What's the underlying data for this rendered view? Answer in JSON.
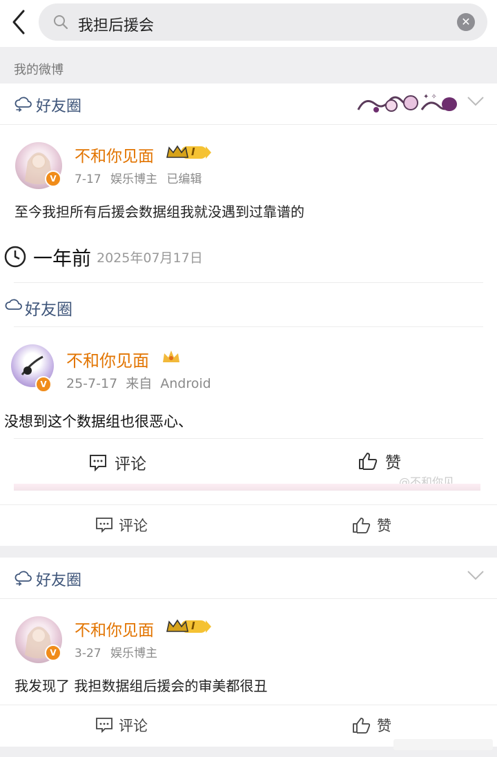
{
  "search": {
    "query": "我担后援会"
  },
  "section_label": "我的微博",
  "posts": [
    {
      "circle": "好友圈",
      "username": "不和你见面",
      "level": "I",
      "meta": "7-17   娱乐博主   已编辑",
      "text": "至今我担所有后援会数据组我就没遇到过靠谱的",
      "embed": {
        "time_label": "一年前",
        "date": "2025年07月17日",
        "circle": "好友圈",
        "username": "不和你见面",
        "meta": "25-7-17  来自 Android",
        "text": "没想到这个数据组也很恶心、",
        "comment": "评论",
        "like": "赞",
        "watermark": "@不和你见"
      },
      "comment": "评论",
      "like": "赞"
    },
    {
      "circle": "好友圈",
      "username": "不和你见面",
      "level": "I",
      "meta": "3-27   娱乐博主",
      "text": "我发现了 我担数据组后援会的审美都很丑",
      "comment": "评论",
      "like": "赞"
    }
  ]
}
